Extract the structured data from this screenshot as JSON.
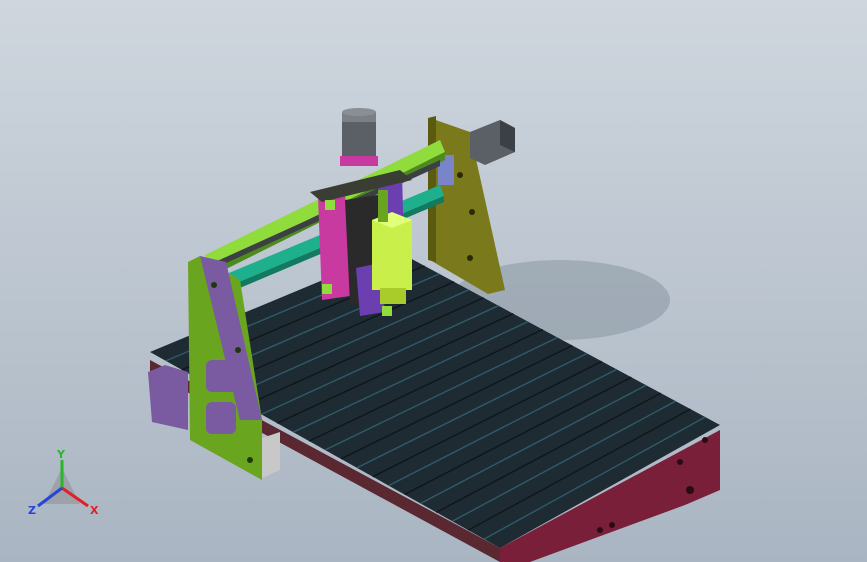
{
  "view": {
    "background_top": "#cfd6de",
    "background_bottom": "#a9b5c2"
  },
  "model": {
    "components": [
      "table-bed",
      "t-slot-extrusions",
      "base-frame",
      "left-gantry-plate",
      "right-gantry-plate",
      "x-axis-rails",
      "x-axis-stepper-motor",
      "z-axis-stepper-motor",
      "z-carriage",
      "spindle"
    ],
    "colors": {
      "bed_slots": "#1e2b33",
      "base_frame": "#7a1f3a",
      "gantry_plate": "#6aa51f",
      "gantry_plate_accent": "#7a5aa0",
      "right_plate": "#7a7a1c",
      "rail": "#8fdc3c",
      "rail_teal": "#1eb08c",
      "spindle": "#c9f04a",
      "motor": "#5b5f66",
      "z_carriage": "#c83aa0",
      "z_carriage_purple": "#6b3fb0"
    }
  },
  "triad": {
    "x_label": "X",
    "y_label": "Y",
    "z_label": "Z",
    "x_color": "#e0202a",
    "y_color": "#2bb52b",
    "z_color": "#2a44d8"
  }
}
